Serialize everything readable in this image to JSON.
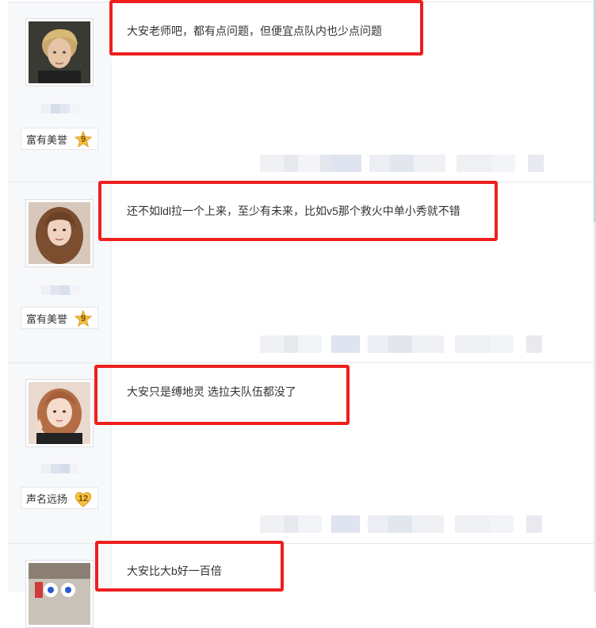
{
  "accent_highlight_color": "#ee1f1f",
  "posts": [
    {
      "content": "大安老师吧，都有点问题，但便宜点队内也少点问题",
      "level_title": "富有美誉",
      "level_num": "9",
      "badge_icon": "star-badge-icon",
      "avatar_icon": "user-avatar"
    },
    {
      "content": "还不如ldl拉一个上来，至少有未来，比如v5那个救火中单小秀就不错",
      "level_title": "富有美誉",
      "level_num": "9",
      "badge_icon": "star-badge-icon",
      "avatar_icon": "user-avatar"
    },
    {
      "content": "大安只是缚地灵 选拉夫队伍都没了",
      "level_title": "声名远扬",
      "level_num": "12",
      "badge_icon": "heart-badge-icon",
      "avatar_icon": "user-avatar"
    },
    {
      "content": "大安比大b好一百倍",
      "avatar_icon": "user-avatar"
    }
  ]
}
